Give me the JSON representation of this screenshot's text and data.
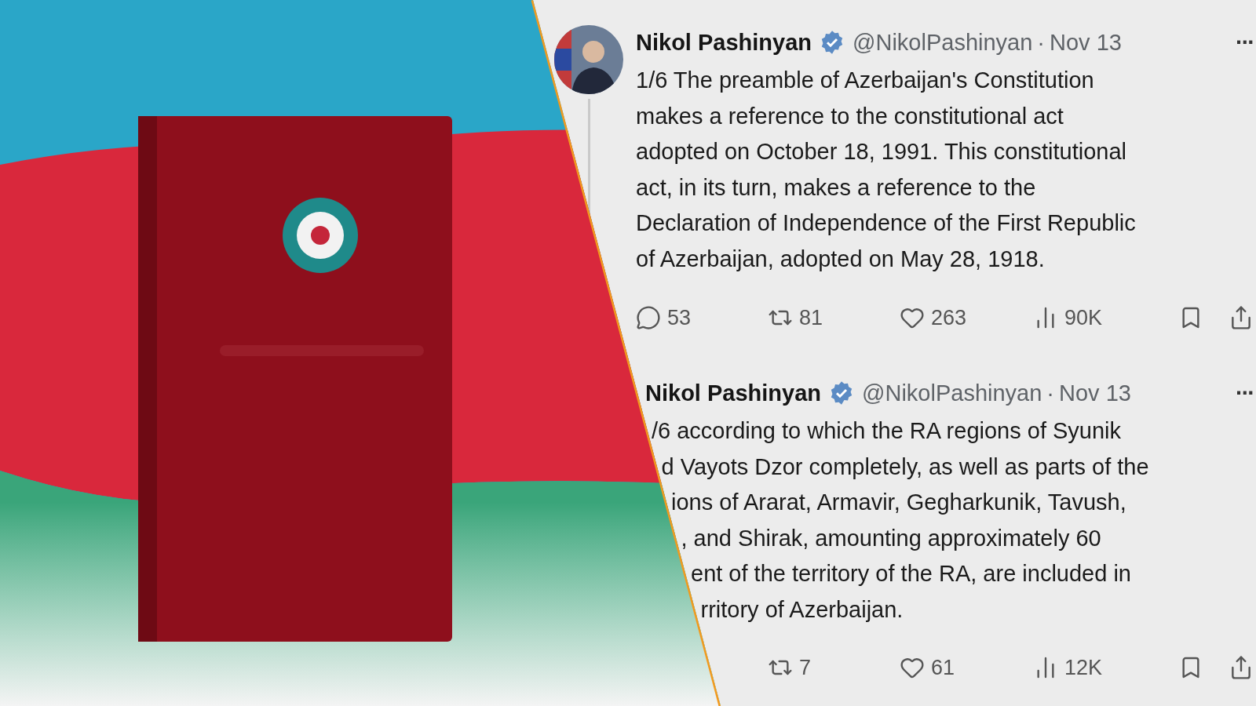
{
  "tweets": [
    {
      "avatar": true,
      "thread_line": true,
      "name": "Nikol Pashinyan",
      "verified": true,
      "handle": "@NikolPashinyan",
      "separator": "·",
      "date": "Nov 13",
      "more": "···",
      "text": "1/6 The preamble of Azerbaijan's Constitution\nmakes a reference to the constitutional act\nadopted on October 18, 1991. This constitutional\nact, in its turn, makes a reference to the\nDeclaration of Independence of the First Republic\nof Azerbaijan, adopted on May 28, 1918.",
      "actions": [
        {
          "kind": "reply",
          "count": "53"
        },
        {
          "kind": "repost",
          "count": "81"
        },
        {
          "kind": "like",
          "count": "263"
        },
        {
          "kind": "views",
          "count": "90K"
        },
        {
          "kind": "bookmark"
        },
        {
          "kind": "share"
        }
      ]
    },
    {
      "avatar": false,
      "thread_line": false,
      "name": "Nikol Pashinyan",
      "verified": true,
      "handle": "@NikolPashinyan",
      "separator": "·",
      "date": "Nov 13",
      "more": "···",
      "lines": [
        "/6 according to which the RA regions of Syunik",
        "d Vayots Dzor completely, as well as parts of the",
        "ions of Ararat, Armavir, Gegharkunik, Tavush,",
        ", and Shirak, amounting approximately 60",
        "ent of the territory of the RA, are included in",
        "rritory of Azerbaijan."
      ],
      "actions": [
        {
          "kind": "repost",
          "count": "7"
        },
        {
          "kind": "like",
          "count": "61"
        },
        {
          "kind": "views",
          "count": "12K"
        },
        {
          "kind": "bookmark"
        },
        {
          "kind": "share"
        }
      ]
    }
  ]
}
